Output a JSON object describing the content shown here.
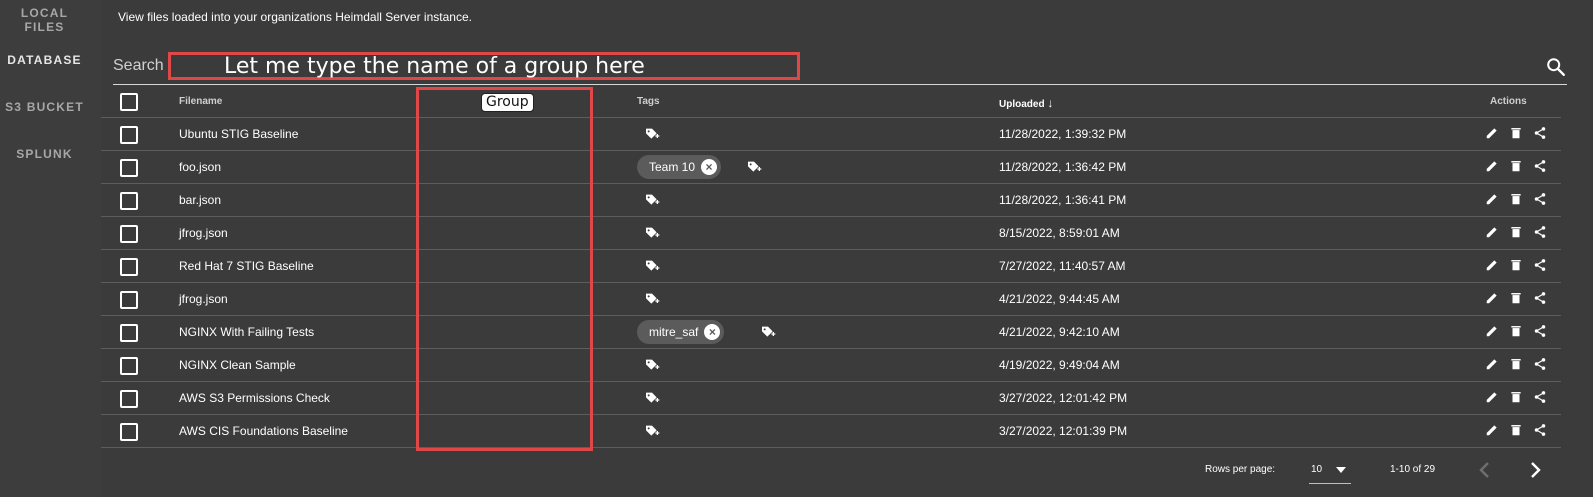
{
  "sidebar": {
    "items": [
      {
        "label": "LOCAL FILES"
      },
      {
        "label": "DATABASE"
      },
      {
        "label": "S3 BUCKET"
      },
      {
        "label": "SPLUNK"
      }
    ]
  },
  "header": {
    "subtitle": "View files loaded into your organizations Heimdall Server instance."
  },
  "search": {
    "label": "Search",
    "value": "",
    "placeholder": ""
  },
  "annotations": {
    "search_note": "Let me type the name of a group here",
    "group_note": "Group"
  },
  "table": {
    "headers": {
      "filename": "Filename",
      "tags": "Tags",
      "uploaded": "Uploaded",
      "uploaded_sort": "↓",
      "actions": "Actions"
    },
    "rows": [
      {
        "filename": "Ubuntu STIG Baseline",
        "tags": [],
        "uploaded": "11/28/2022, 1:39:32 PM"
      },
      {
        "filename": "foo.json",
        "tags": [
          "Team 10"
        ],
        "uploaded": "11/28/2022, 1:36:42 PM"
      },
      {
        "filename": "bar.json",
        "tags": [],
        "uploaded": "11/28/2022, 1:36:41 PM"
      },
      {
        "filename": "jfrog.json",
        "tags": [],
        "uploaded": "8/15/2022, 8:59:01 AM"
      },
      {
        "filename": "Red Hat 7 STIG Baseline",
        "tags": [],
        "uploaded": "7/27/2022, 11:40:57 AM"
      },
      {
        "filename": "jfrog.json",
        "tags": [],
        "uploaded": "4/21/2022, 9:44:45 AM"
      },
      {
        "filename": "NGINX With Failing Tests",
        "tags": [
          "mitre_saf"
        ],
        "uploaded": "4/21/2022, 9:42:10 AM"
      },
      {
        "filename": "NGINX Clean Sample",
        "tags": [],
        "uploaded": "4/19/2022, 9:49:04 AM"
      },
      {
        "filename": "AWS S3 Permissions Check",
        "tags": [],
        "uploaded": "3/27/2022, 12:01:42 PM"
      },
      {
        "filename": "AWS CIS Foundations Baseline",
        "tags": [],
        "uploaded": "3/27/2022, 12:01:39 PM"
      }
    ]
  },
  "footer": {
    "rows_per_page_label": "Rows per page:",
    "rows_per_page_value": "10",
    "page_info": "1-10 of 29"
  },
  "icons": {
    "search": "magnify-icon",
    "tag_add": "tag-plus-icon",
    "chip_close": "close-circle-icon",
    "edit": "pencil-icon",
    "delete": "trash-icon",
    "share": "share-icon"
  },
  "colors": {
    "background": "#3b3b3b",
    "annotation": "#e04848",
    "chip": "#5b5b5b"
  }
}
